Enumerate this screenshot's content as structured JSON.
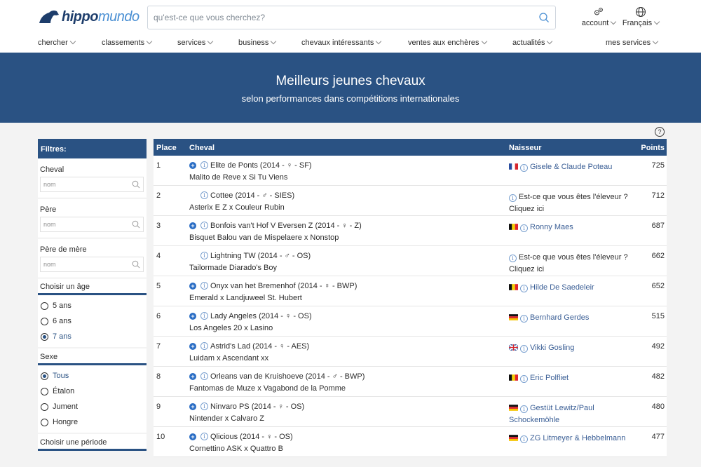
{
  "header": {
    "logo_part1": "hippo",
    "logo_part2": "mundo",
    "search_placeholder": "qu'est-ce que vous cherchez?",
    "account_label": "account",
    "language_label": "Français"
  },
  "nav": [
    "chercher",
    "classements",
    "services",
    "business",
    "chevaux intéressants",
    "ventes aux enchères",
    "actualités",
    "mes services"
  ],
  "banner": {
    "title": "Meilleurs jeunes chevaux",
    "subtitle": "selon performances dans compétitions internationales"
  },
  "help_icon": "?",
  "filters": {
    "title": "Filtres:",
    "cheval_label": "Cheval",
    "pere_label": "Père",
    "pere_mere_label": "Père de mère",
    "input_placeholder": "nom",
    "age_title": "Choisir un âge",
    "ages": [
      "5 ans",
      "6 ans",
      "7 ans"
    ],
    "age_selected": "7 ans",
    "sexe_title": "Sexe",
    "sexes": [
      "Tous",
      "Étalon",
      "Jument",
      "Hongre"
    ],
    "sexe_selected": "Tous",
    "period_title": "Choisir une période"
  },
  "table": {
    "headers": {
      "place": "Place",
      "cheval": "Cheval",
      "naisseur": "Naisseur",
      "points": "Points"
    },
    "rows": [
      {
        "place": "1",
        "horse": "Elite de Ponts (2014 - ♀ - SF)",
        "pedigree": "Malito de Reve x Si Tu Viens",
        "flag": "fr",
        "breeder": "Gisele & Claude Poteau",
        "breeder2": "",
        "points": "725",
        "plus": true
      },
      {
        "place": "2",
        "horse": "Cottee (2014 - ♂ - SIES)",
        "pedigree": "Asterix E Z x Couleur Rubin",
        "flag": "",
        "breeder": "Est-ce que vous êtes l'éleveur ?",
        "breeder2": "Cliquez ici",
        "points": "712",
        "plus": false
      },
      {
        "place": "3",
        "horse": "Bonfois van't Hof V Eversen Z (2014 - ♀ - Z)",
        "pedigree": "Bisquet Balou van de Mispelaere x Nonstop",
        "flag": "be",
        "breeder": "Ronny Maes",
        "breeder2": "",
        "points": "687",
        "plus": true
      },
      {
        "place": "4",
        "horse": "Lightning TW (2014 - ♂ - OS)",
        "pedigree": "Tailormade Diarado's Boy",
        "flag": "",
        "breeder": "Est-ce que vous êtes l'éleveur ?",
        "breeder2": "Cliquez ici",
        "points": "662",
        "plus": false
      },
      {
        "place": "5",
        "horse": "Onyx van het Bremenhof (2014 - ♀ - BWP)",
        "pedigree": "Emerald x Landjuweel St. Hubert",
        "flag": "be",
        "breeder": "Hilde De Saedeleir",
        "breeder2": "",
        "points": "652",
        "plus": true
      },
      {
        "place": "6",
        "horse": "Lady Angeles (2014 - ♀ - OS)",
        "pedigree": "Los Angeles 20 x Lasino",
        "flag": "de",
        "breeder": "Bernhard Gerdes",
        "breeder2": "",
        "points": "515",
        "plus": true
      },
      {
        "place": "7",
        "horse": "Astrid's Lad (2014 - ♀ - AES)",
        "pedigree": "Luidam x Ascendant xx",
        "flag": "gb",
        "breeder": "Vikki Gosling",
        "breeder2": "",
        "points": "492",
        "plus": true
      },
      {
        "place": "8",
        "horse": "Orleans van de Kruishoeve (2014 - ♂ - BWP)",
        "pedigree": "Fantomas de Muze x Vagabond de la Pomme",
        "flag": "be",
        "breeder": "Eric Polfliet",
        "breeder2": "",
        "points": "482",
        "plus": true
      },
      {
        "place": "9",
        "horse": "Ninvaro PS (2014 - ♀ - OS)",
        "pedigree": "Nintender x Calvaro Z",
        "flag": "de",
        "breeder": "Gestüt Lewitz/Paul",
        "breeder2": "Schockemöhle",
        "points": "480",
        "plus": true
      },
      {
        "place": "10",
        "horse": "Qlicious (2014 - ♀ - OS)",
        "pedigree": "Cornettino ASK x Quattro B",
        "flag": "de",
        "breeder": "ZG Litmeyer & Hebbelmann",
        "breeder2": "",
        "points": "477",
        "plus": true
      }
    ]
  },
  "colors": {
    "brand": "#2a5283",
    "link": "#3a5e95"
  }
}
